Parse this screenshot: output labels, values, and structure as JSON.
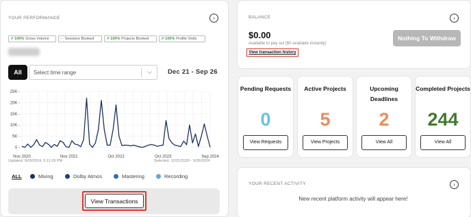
{
  "performance": {
    "title": "YOUR PERFORMANCE",
    "chips": [
      {
        "indicator": "↗ 100%",
        "label": "Gross Volume",
        "style": "up"
      },
      {
        "indicator": "--",
        "label": "Sessions Booked",
        "style": "dash"
      },
      {
        "indicator": "↗ 100%",
        "label": "Projects Booked",
        "style": "up"
      },
      {
        "indicator": "↗ 100%",
        "label": "Profile Visits",
        "style": "up"
      }
    ],
    "all_label": "All",
    "time_range_placeholder": "Select time range",
    "date_range": "Dec 21 - Sep 26",
    "updated": "Updated: 9/26/2024, 5:11:29 PM",
    "selected": "Selected: 12/21/2020 - 9/26/2024",
    "legend": {
      "all": "ALL",
      "items": [
        {
          "label": "Mixing",
          "color": "#1d2f5e"
        },
        {
          "label": "Dolby Atmos",
          "color": "#1f3d7a"
        },
        {
          "label": "Mastering",
          "color": "#2f6fb0"
        },
        {
          "label": "Recording",
          "color": "#6aa3d4"
        }
      ]
    },
    "view_transactions": "View Transactions"
  },
  "chart_data": {
    "type": "line",
    "x_ticks": [
      "Nov 2020",
      "Nov 2021",
      "Oct 2022",
      "Oct 2023",
      "Sep 2024"
    ],
    "y_ticks": [
      "0",
      "5K",
      "10K",
      "15K",
      "20K",
      "25K"
    ],
    "ylim": [
      0,
      25000
    ],
    "grid": true,
    "color": "#1d2f5e",
    "series": [
      {
        "values": [
          500,
          0,
          1500,
          0,
          1200,
          3500,
          1000,
          400,
          2200,
          1400,
          0,
          1300,
          500,
          3000,
          2200,
          300,
          0,
          3000,
          1500,
          1200,
          300,
          3500,
          22000,
          1500,
          0,
          2000,
          8000,
          21000,
          8000,
          1000,
          1000,
          8000,
          19000,
          5000,
          800,
          1000,
          900,
          700,
          1000,
          600,
          200,
          0,
          500,
          1000,
          1300,
          1000,
          500,
          800,
          1000,
          12000,
          4000,
          2000,
          1000,
          700,
          400,
          2800,
          1200,
          10000,
          2000,
          6000,
          400,
          5000,
          10500,
          5000,
          0
        ]
      }
    ]
  },
  "balance": {
    "title": "BALANCE",
    "amount": "$0.00",
    "available": "Available to pay out ($0 available instantly)",
    "history_link": "View transaction history",
    "withdraw_button": "Nothing To Withdraw"
  },
  "stats": [
    {
      "title": "Pending Requests",
      "value": "0",
      "color": "#6cc0e0",
      "button": "View Requests"
    },
    {
      "title": "Active Projects",
      "value": "5",
      "color": "#f08a5d",
      "button": "View Projects"
    },
    {
      "title": "Upcoming Deadlines",
      "value": "2",
      "color": "#f08a5d",
      "button": "View All"
    },
    {
      "title": "Completed Projects",
      "value": "244",
      "color": "#3f7a2e",
      "button": "View All"
    }
  ],
  "activity": {
    "title": "YOUR RECENT ACTIVITY",
    "empty_message": "New recent platform activity will appear here!"
  },
  "icons": {
    "arrow": "arrow-right-circle-icon",
    "chevron": "chevron-down-icon"
  }
}
